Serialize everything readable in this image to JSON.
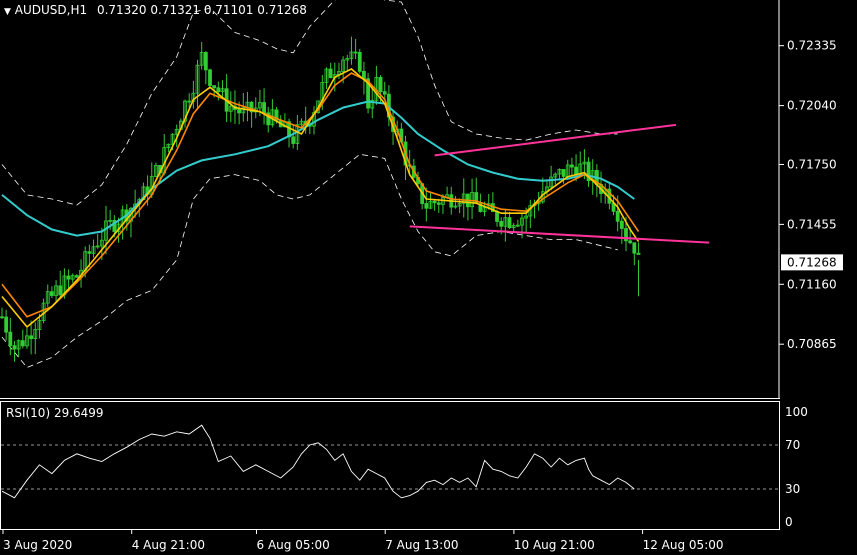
{
  "header": {
    "arrow": "▼",
    "symbol": "AUDUSD,H1",
    "ohlc": "0.71320 0.71321 0.71101 0.71268"
  },
  "rsi_header": "RSI(10) 29.6499",
  "colors": {
    "background": "#000000",
    "candle": "#33cc33",
    "ma_fast": "#ffcc00",
    "ma_mid": "#ff8800",
    "ma_slow": "#33cccc",
    "bands": "#ffffff",
    "trendline": "#ff3399",
    "rsi": "#ffffff",
    "price_box_bg": "#ffffff",
    "price_box_text": "#000000"
  },
  "chart_data": [
    {
      "type": "candlestick",
      "title": "AUDUSD,H1",
      "price_axis": {
        "ticks": [
          "0.72335",
          "0.72040",
          "0.71750",
          "0.71455",
          "0.71160",
          "0.70865"
        ],
        "ylim": [
          0.706,
          0.7256
        ],
        "current_price": "0.71268"
      },
      "time_axis": [
        "3 Aug 2020",
        "4 Aug 21:00",
        "6 Aug 05:00",
        "7 Aug 13:00",
        "10 Aug 21:00",
        "12 Aug 05:00"
      ],
      "close_path": [
        [
          0,
          0.71
        ],
        [
          3,
          0.7085
        ],
        [
          6,
          0.709
        ],
        [
          10,
          0.7105
        ],
        [
          14,
          0.7115
        ],
        [
          18,
          0.712
        ],
        [
          22,
          0.7135
        ],
        [
          26,
          0.7145
        ],
        [
          30,
          0.7152
        ],
        [
          34,
          0.716
        ],
        [
          38,
          0.7175
        ],
        [
          42,
          0.7195
        ],
        [
          46,
          0.7215
        ],
        [
          48,
          0.7228
        ],
        [
          50,
          0.7218
        ],
        [
          54,
          0.7205
        ],
        [
          58,
          0.72
        ],
        [
          62,
          0.7203
        ],
        [
          66,
          0.7195
        ],
        [
          70,
          0.7188
        ],
        [
          74,
          0.7198
        ],
        [
          78,
          0.7218
        ],
        [
          82,
          0.7228
        ],
        [
          86,
          0.7225
        ],
        [
          88,
          0.7205
        ],
        [
          90,
          0.7215
        ],
        [
          93,
          0.72
        ],
        [
          96,
          0.7185
        ],
        [
          99,
          0.7165
        ],
        [
          102,
          0.7155
        ],
        [
          106,
          0.7158
        ],
        [
          110,
          0.716
        ],
        [
          114,
          0.7155
        ],
        [
          118,
          0.715
        ],
        [
          122,
          0.7148
        ],
        [
          126,
          0.715
        ],
        [
          130,
          0.7162
        ],
        [
          134,
          0.717
        ],
        [
          138,
          0.7175
        ],
        [
          142,
          0.7168
        ],
        [
          146,
          0.716
        ],
        [
          148,
          0.7152
        ],
        [
          150,
          0.714
        ],
        [
          152,
          0.7135
        ],
        [
          153,
          0.7127
        ]
      ],
      "ma_fast": [
        [
          0,
          0.711
        ],
        [
          6,
          0.7095
        ],
        [
          12,
          0.7105
        ],
        [
          18,
          0.7118
        ],
        [
          24,
          0.7133
        ],
        [
          30,
          0.7148
        ],
        [
          36,
          0.7163
        ],
        [
          42,
          0.7188
        ],
        [
          46,
          0.7207
        ],
        [
          50,
          0.7213
        ],
        [
          56,
          0.7203
        ],
        [
          62,
          0.7201
        ],
        [
          68,
          0.7194
        ],
        [
          72,
          0.719
        ],
        [
          76,
          0.7203
        ],
        [
          80,
          0.7218
        ],
        [
          84,
          0.7222
        ],
        [
          88,
          0.7215
        ],
        [
          92,
          0.7205
        ],
        [
          95,
          0.7188
        ],
        [
          98,
          0.717
        ],
        [
          102,
          0.7158
        ],
        [
          108,
          0.7157
        ],
        [
          114,
          0.7156
        ],
        [
          120,
          0.7151
        ],
        [
          126,
          0.7151
        ],
        [
          130,
          0.716
        ],
        [
          136,
          0.7169
        ],
        [
          140,
          0.7171
        ],
        [
          144,
          0.7163
        ],
        [
          148,
          0.7154
        ],
        [
          151,
          0.7143
        ],
        [
          153,
          0.7137
        ]
      ],
      "ma_mid": [
        [
          0,
          0.7116
        ],
        [
          6,
          0.71
        ],
        [
          12,
          0.7105
        ],
        [
          18,
          0.7117
        ],
        [
          24,
          0.713
        ],
        [
          30,
          0.7145
        ],
        [
          36,
          0.716
        ],
        [
          42,
          0.7182
        ],
        [
          46,
          0.72
        ],
        [
          50,
          0.721
        ],
        [
          56,
          0.7205
        ],
        [
          62,
          0.7201
        ],
        [
          68,
          0.7196
        ],
        [
          72,
          0.7193
        ],
        [
          76,
          0.7202
        ],
        [
          80,
          0.7214
        ],
        [
          84,
          0.722
        ],
        [
          88,
          0.7216
        ],
        [
          92,
          0.7207
        ],
        [
          95,
          0.7192
        ],
        [
          98,
          0.7175
        ],
        [
          102,
          0.7162
        ],
        [
          108,
          0.7158
        ],
        [
          114,
          0.7157
        ],
        [
          120,
          0.7153
        ],
        [
          126,
          0.7152
        ],
        [
          130,
          0.7158
        ],
        [
          136,
          0.7166
        ],
        [
          140,
          0.717
        ],
        [
          144,
          0.7165
        ],
        [
          148,
          0.7157
        ],
        [
          151,
          0.7148
        ],
        [
          153,
          0.7142
        ]
      ],
      "ma_slow": [
        [
          0,
          0.716
        ],
        [
          6,
          0.715
        ],
        [
          12,
          0.7143
        ],
        [
          18,
          0.714
        ],
        [
          24,
          0.7142
        ],
        [
          30,
          0.715
        ],
        [
          36,
          0.7163
        ],
        [
          42,
          0.7172
        ],
        [
          48,
          0.7177
        ],
        [
          56,
          0.718
        ],
        [
          64,
          0.7184
        ],
        [
          70,
          0.719
        ],
        [
          76,
          0.7197
        ],
        [
          82,
          0.7203
        ],
        [
          88,
          0.7206
        ],
        [
          92,
          0.7205
        ],
        [
          96,
          0.7198
        ],
        [
          100,
          0.719
        ],
        [
          106,
          0.7182
        ],
        [
          112,
          0.7175
        ],
        [
          118,
          0.7171
        ],
        [
          124,
          0.7168
        ],
        [
          130,
          0.7167
        ],
        [
          136,
          0.7168
        ],
        [
          140,
          0.717
        ],
        [
          144,
          0.7168
        ],
        [
          148,
          0.7164
        ],
        [
          152,
          0.7158
        ]
      ],
      "band_upper": [
        [
          0,
          0.7175
        ],
        [
          6,
          0.716
        ],
        [
          12,
          0.7158
        ],
        [
          18,
          0.7155
        ],
        [
          24,
          0.7165
        ],
        [
          30,
          0.7185
        ],
        [
          36,
          0.721
        ],
        [
          42,
          0.7228
        ],
        [
          46,
          0.725
        ],
        [
          50,
          0.7252
        ],
        [
          56,
          0.724
        ],
        [
          62,
          0.7236
        ],
        [
          66,
          0.7232
        ],
        [
          70,
          0.723
        ],
        [
          74,
          0.7243
        ],
        [
          80,
          0.7256
        ],
        [
          86,
          0.7262
        ],
        [
          92,
          0.7256
        ],
        [
          96,
          0.7255
        ],
        [
          100,
          0.7238
        ],
        [
          104,
          0.7214
        ],
        [
          108,
          0.7196
        ],
        [
          114,
          0.719
        ],
        [
          120,
          0.7188
        ],
        [
          126,
          0.7187
        ],
        [
          132,
          0.719
        ],
        [
          138,
          0.7192
        ],
        [
          144,
          0.719
        ],
        [
          148,
          0.719
        ]
      ],
      "band_lower": [
        [
          0,
          0.709
        ],
        [
          6,
          0.7075
        ],
        [
          12,
          0.708
        ],
        [
          18,
          0.709
        ],
        [
          24,
          0.7098
        ],
        [
          30,
          0.7108
        ],
        [
          36,
          0.7113
        ],
        [
          42,
          0.7128
        ],
        [
          46,
          0.7158
        ],
        [
          50,
          0.7168
        ],
        [
          56,
          0.717
        ],
        [
          62,
          0.7167
        ],
        [
          66,
          0.716
        ],
        [
          70,
          0.7158
        ],
        [
          74,
          0.716
        ],
        [
          80,
          0.717
        ],
        [
          86,
          0.718
        ],
        [
          92,
          0.7178
        ],
        [
          96,
          0.7158
        ],
        [
          100,
          0.7142
        ],
        [
          104,
          0.7132
        ],
        [
          108,
          0.713
        ],
        [
          114,
          0.714
        ],
        [
          120,
          0.7142
        ],
        [
          126,
          0.714
        ],
        [
          132,
          0.7138
        ],
        [
          138,
          0.7138
        ],
        [
          144,
          0.7135
        ],
        [
          148,
          0.7133
        ]
      ],
      "trendlines": [
        {
          "from": [
            104,
            0.71795
          ],
          "to": [
            162,
            0.71945
          ]
        },
        {
          "from": [
            98,
            0.71445
          ],
          "to": [
            170,
            0.71365
          ]
        }
      ]
    },
    {
      "type": "line",
      "title": "RSI(10) 29.6499",
      "ylim": [
        0,
        100
      ],
      "ticks": [
        "100",
        "70",
        "30",
        "0"
      ],
      "levels": [
        70,
        30
      ],
      "values": [
        [
          0,
          28
        ],
        [
          3,
          22
        ],
        [
          6,
          38
        ],
        [
          9,
          52
        ],
        [
          12,
          44
        ],
        [
          15,
          56
        ],
        [
          18,
          62
        ],
        [
          21,
          58
        ],
        [
          24,
          55
        ],
        [
          27,
          62
        ],
        [
          30,
          68
        ],
        [
          33,
          75
        ],
        [
          36,
          80
        ],
        [
          39,
          78
        ],
        [
          42,
          82
        ],
        [
          45,
          80
        ],
        [
          48,
          88
        ],
        [
          50,
          76
        ],
        [
          52,
          55
        ],
        [
          55,
          60
        ],
        [
          58,
          46
        ],
        [
          61,
          52
        ],
        [
          64,
          46
        ],
        [
          67,
          40
        ],
        [
          70,
          50
        ],
        [
          72,
          62
        ],
        [
          74,
          70
        ],
        [
          76,
          72
        ],
        [
          78,
          66
        ],
        [
          80,
          56
        ],
        [
          82,
          62
        ],
        [
          84,
          46
        ],
        [
          86,
          38
        ],
        [
          88,
          48
        ],
        [
          90,
          44
        ],
        [
          92,
          40
        ],
        [
          94,
          28
        ],
        [
          96,
          22
        ],
        [
          98,
          24
        ],
        [
          100,
          28
        ],
        [
          102,
          36
        ],
        [
          104,
          38
        ],
        [
          106,
          34
        ],
        [
          108,
          40
        ],
        [
          110,
          36
        ],
        [
          112,
          40
        ],
        [
          114,
          32
        ],
        [
          116,
          56
        ],
        [
          118,
          48
        ],
        [
          120,
          46
        ],
        [
          122,
          42
        ],
        [
          124,
          40
        ],
        [
          126,
          50
        ],
        [
          128,
          62
        ],
        [
          130,
          58
        ],
        [
          132,
          50
        ],
        [
          134,
          58
        ],
        [
          136,
          52
        ],
        [
          138,
          56
        ],
        [
          140,
          58
        ],
        [
          141,
          48
        ],
        [
          142,
          42
        ],
        [
          144,
          38
        ],
        [
          146,
          34
        ],
        [
          148,
          40
        ],
        [
          150,
          36
        ],
        [
          152,
          30
        ]
      ]
    }
  ]
}
